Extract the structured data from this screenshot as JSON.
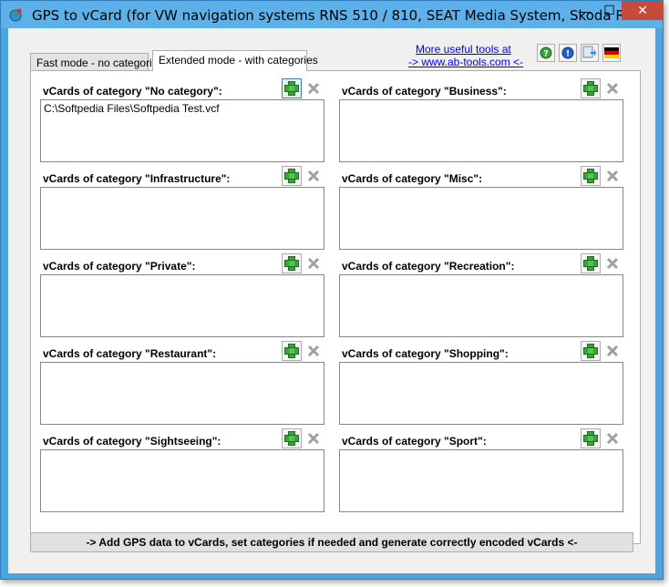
{
  "window": {
    "title": "GPS to vCard (for VW navigation systems RNS 510 / 810, SEAT Media System, Skoda R...",
    "minimize_glyph": "—",
    "maximize_glyph": "☐",
    "close_glyph": "✕"
  },
  "tabs": [
    {
      "label": "Fast mode - no categories",
      "selected": false
    },
    {
      "label": "Extended mode - with categories",
      "selected": true
    }
  ],
  "links": {
    "line1": "More useful tools at",
    "line2": "-> www.ab-tools.com <-"
  },
  "toolbar_icons": [
    "help-icon",
    "info-icon",
    "update-icon",
    "german-flag-icon"
  ],
  "categories": [
    {
      "label": "vCards of category \"No category\":",
      "items": [
        "C:\\Softpedia Files\\Softpedia Test.vcf"
      ]
    },
    {
      "label": "vCards of category \"Business\":",
      "items": []
    },
    {
      "label": "vCards of category \"Infrastructure\":",
      "items": []
    },
    {
      "label": "vCards of category \"Misc\":",
      "items": []
    },
    {
      "label": "vCards of category \"Private\":",
      "items": []
    },
    {
      "label": "vCards of category \"Recreation\":",
      "items": []
    },
    {
      "label": "vCards of category \"Restaurant\":",
      "items": []
    },
    {
      "label": "vCards of category \"Shopping\":",
      "items": []
    },
    {
      "label": "vCards of category \"Sightseeing\":",
      "items": []
    },
    {
      "label": "vCards of category \"Sport\":",
      "items": []
    }
  ],
  "bottom_button": "-> Add GPS data to vCards, set categories if needed and generate correctly encoded vCards <-",
  "colors": {
    "add_green": "#3aa23a",
    "delete_gray": "#a0a0a0",
    "link_blue": "#0000ee",
    "title_bar": "#5eb0e8",
    "close_red": "#c74b3c"
  }
}
